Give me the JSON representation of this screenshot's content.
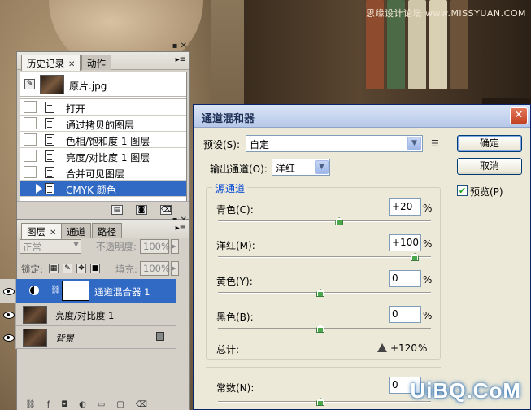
{
  "watermark": {
    "top": "思缘设计论坛 www.MISSYUAN.COM",
    "bottom": "UiBQ.CoM"
  },
  "history": {
    "tabs": [
      "历史记录",
      "动作"
    ],
    "snapshot_label": "原片.jpg",
    "items": [
      "打开",
      "通过拷贝的图层",
      "色相/饱和度 1 图层",
      "亮度/对比度 1 图层",
      "合并可见图层",
      "CMYK 颜色"
    ],
    "selected_index": 5
  },
  "layers": {
    "tabs": [
      "图层",
      "通道",
      "路径"
    ],
    "blend_mode": "正常",
    "opacity_label": "不透明度:",
    "opacity_value": "100%",
    "lock_label": "锁定:",
    "fill_label": "填充:",
    "fill_value": "100%",
    "items": [
      "通道混合器 1",
      "亮度/对比度 1",
      "背景"
    ]
  },
  "dialog": {
    "title": "通道混和器",
    "preset_label": "预设(S):",
    "preset_value": "自定",
    "output_label": "输出通道(O):",
    "output_value": "洋红",
    "ok_label": "确定",
    "cancel_label": "取消",
    "preview_label": "预览(P)",
    "preview_checked": true,
    "source_group": "源通道",
    "sliders": [
      {
        "label": "青色(C):",
        "value": "+20",
        "fraction": 0.6
      },
      {
        "label": "洋红(M):",
        "value": "+100",
        "fraction": 1.0
      },
      {
        "label": "黄色(Y):",
        "value": "0",
        "fraction": 0.5
      },
      {
        "label": "黑色(B):",
        "value": "0",
        "fraction": 0.5
      }
    ],
    "total_label": "总计:",
    "total_value": "+120",
    "percent": "%",
    "constant_label": "常数(N):",
    "constant_value": "0",
    "constant_fraction": 0.5
  },
  "colors": {
    "selection": "#316ac5",
    "dialog_bg": "#ece9d8",
    "group_title": "#0046d5"
  }
}
